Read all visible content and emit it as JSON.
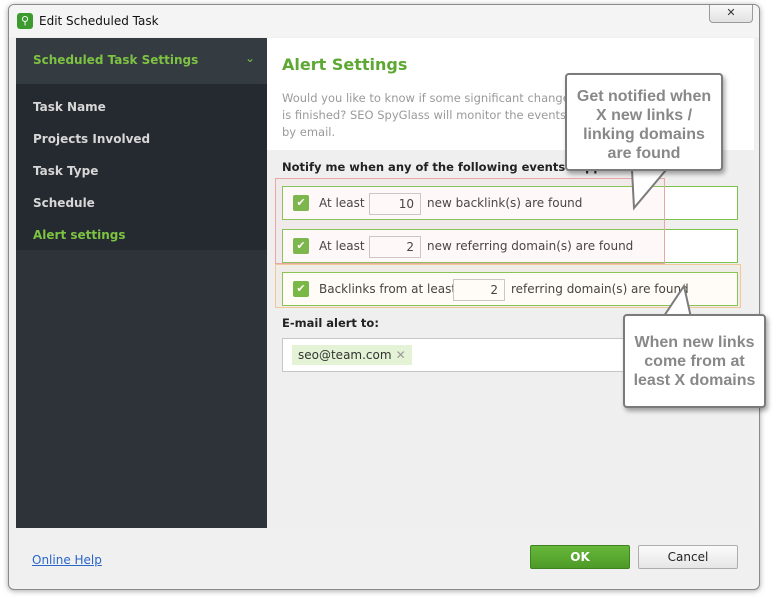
{
  "window": {
    "title": "Edit Scheduled Task",
    "close_glyph": "✕"
  },
  "sidebar": {
    "header": "Scheduled Task Settings",
    "items": [
      {
        "label": "Task Name"
      },
      {
        "label": "Projects Involved"
      },
      {
        "label": "Task Type"
      },
      {
        "label": "Schedule"
      },
      {
        "label": "Alert settings",
        "active": true
      }
    ]
  },
  "content": {
    "title": "Alert Settings",
    "description_lines": [
      "Would you like to know if some significant changes c",
      "is finished? SEO SpyGlass will monitor the events yo",
      "by email."
    ],
    "events_label": "Notify me when any of the following events happen",
    "events": [
      {
        "prefix": "At least",
        "value": "10",
        "suffix": "new backlink(s) are found"
      },
      {
        "prefix": "At least",
        "value": "2",
        "suffix": "new referring domain(s) are found"
      },
      {
        "prefix": "Backlinks from at least",
        "value": "2",
        "suffix": "referring domain(s) are found"
      }
    ],
    "email_label": "E-mail alert to:",
    "email_chip": "seo@team.com"
  },
  "callouts": {
    "top": [
      "Get notified when",
      "X new links /",
      "linking domains",
      "are found"
    ],
    "bottom": [
      "When new links",
      "come from at",
      "least X domains"
    ]
  },
  "footer": {
    "help": "Online Help",
    "ok": "OK",
    "cancel": "Cancel"
  },
  "colors": {
    "accent_green": "#7dc243",
    "sidebar_bg": "#2d3338",
    "link_blue": "#2a66c8"
  }
}
